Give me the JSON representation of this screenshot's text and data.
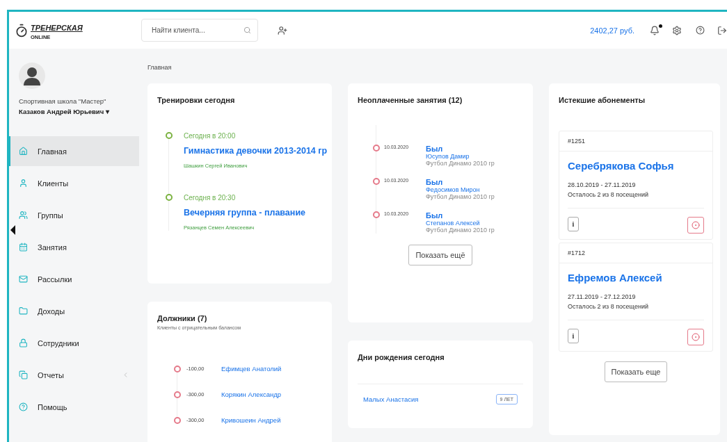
{
  "header": {
    "logo": "ТРЕНЕРСКАЯ",
    "logo_sub": "ONLINE",
    "search": {
      "placeholder": "Найти клиента..."
    },
    "balance": "2402,27 руб.",
    "notifications_unread": true
  },
  "profile": {
    "school": "Спортивная школа \"Мастер\"",
    "name": "Казаков Андрей Юрьевич",
    "caret": "▾"
  },
  "sidebar": {
    "items": [
      {
        "label": "Главная",
        "selected": true
      },
      {
        "label": "Клиенты",
        "selected": false
      },
      {
        "label": "Группы",
        "selected": false
      },
      {
        "label": "Занятия",
        "selected": false
      },
      {
        "label": "Рассылки",
        "selected": false
      },
      {
        "label": "Доходы",
        "selected": false
      },
      {
        "label": "Сотрудники",
        "selected": false
      },
      {
        "label": "Отчеты",
        "selected": false,
        "expandable": true
      },
      {
        "label": "Помощь",
        "selected": false
      }
    ]
  },
  "breadcrumb": "Главная",
  "trainings": {
    "title": "Тренировки сегодня",
    "items": [
      {
        "time": "Сегодня в 20:00",
        "group": "Гимнастика девочки 2013-2014 гр",
        "trainer": "Шашкин Сергей Иванович"
      },
      {
        "time": "Сегодня в 20:30",
        "group": "Вечерняя группа - плавание",
        "trainer": "Рязанцев Семен Алексеевич"
      }
    ]
  },
  "debtors": {
    "title": "Должники (7)",
    "subtitle": "Клиенты с отрицательным балансом",
    "items": [
      {
        "amount": "-100,00",
        "name": "Ефимцев Анатолий"
      },
      {
        "amount": "-300,00",
        "name": "Корякин Александр"
      },
      {
        "amount": "-300,00",
        "name": "Кривошеин Андрей"
      }
    ]
  },
  "unpaid": {
    "title": "Неоплаченные занятия (12)",
    "items": [
      {
        "date": "10.03.2020",
        "status": "Был",
        "client": "Юсупов Дамир",
        "group": "Футбол Динамо 2010 гр"
      },
      {
        "date": "10.03.2020",
        "status": "Был",
        "client": "Федосимов Мирон",
        "group": "Футбол Динамо 2010 гр"
      },
      {
        "date": "10.03.2020",
        "status": "Был",
        "client": "Степанов Алексей",
        "group": "Футбол Динамо 2010 гр"
      }
    ],
    "more": "Показать ещё"
  },
  "birthdays": {
    "title": "Дни рождения сегодня",
    "items": [
      {
        "name": "Малых Анастасия",
        "age": "9 ЛЕТ"
      }
    ]
  },
  "expired": {
    "title": "Истекшие абонементы",
    "items": [
      {
        "number": "#1251",
        "client": "Серебрякова Софья",
        "period": "28.10.2019 - 27.11.2019",
        "remaining": "Осталось 2 из 8 посещений",
        "info": "i"
      },
      {
        "number": "#1712",
        "client": "Ефремов Алексей",
        "period": "27.11.2019 - 27.12.2019",
        "remaining": "Осталось 2 из 8 посещений",
        "info": "i"
      }
    ],
    "more": "Показать еще"
  }
}
